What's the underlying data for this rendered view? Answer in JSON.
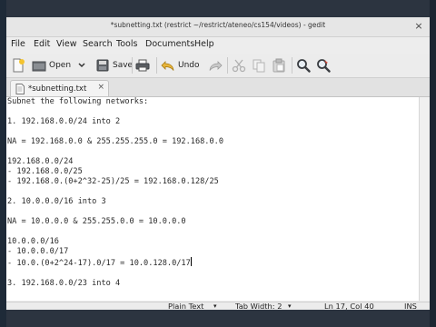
{
  "window": {
    "title": "*subnetting.txt (restrict ~/restrict/ateneo/cs154/videos) - gedit",
    "close_glyph": "×"
  },
  "menu": [
    "File",
    "Edit",
    "View",
    "Search",
    "Tools",
    "Documents",
    "Help"
  ],
  "toolbar": {
    "new_icon": "new-document-icon",
    "open_label": "Open",
    "open_icon": "folder-open-icon",
    "save_label": "Save",
    "save_icon": "save-disk-icon",
    "print_icon": "printer-icon",
    "undo_label": "Undo",
    "undo_icon": "undo-arrow-icon",
    "redo_icon": "redo-arrow-icon",
    "cut_icon": "scissors-icon",
    "copy_icon": "copy-icon",
    "paste_icon": "paste-icon",
    "find_icon": "magnifier-icon",
    "replace_icon": "find-replace-icon"
  },
  "tab": {
    "label": "*subnetting.txt",
    "close_glyph": "×"
  },
  "editor": {
    "lines": [
      "Subnet the following networks:",
      "",
      "1. 192.168.0.0/24 into 2",
      "",
      "NA = 192.168.0.0 & 255.255.255.0 = 192.168.0.0",
      "",
      "192.168.0.0/24",
      "- 192.168.0.0/25",
      "- 192.168.0.(0+2^32-25)/25 = 192.168.0.128/25",
      "",
      "2. 10.0.0.0/16 into 3",
      "",
      "NA = 10.0.0.0 & 255.255.0.0 = 10.0.0.0",
      "",
      "10.0.0.0/16",
      "- 10.0.0.0/17",
      "- 10.0.(0+2^24-17).0/17 = 10.0.128.0/17",
      "",
      "3. 192.168.0.0/23 into 4"
    ],
    "caret_line": 16
  },
  "status": {
    "language": "Plain Text",
    "tab_width": "Tab Width:  2",
    "position": "Ln 17, Col 40",
    "mode": "INS",
    "dropdown_glyph": "▾"
  },
  "colors": {
    "desktop": "#2c3440",
    "window_bg": "#ededed",
    "editor_bg": "#ffffff"
  }
}
